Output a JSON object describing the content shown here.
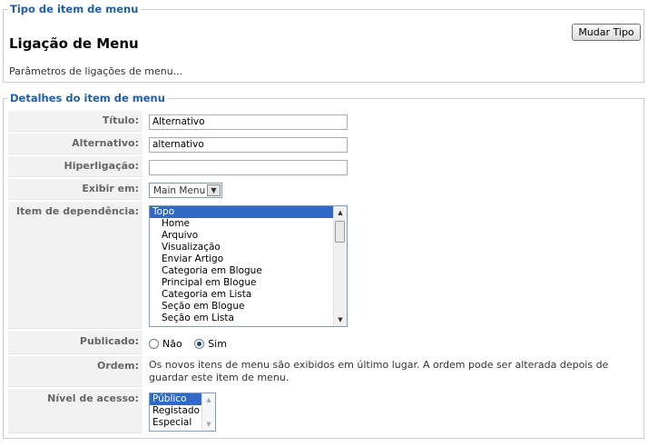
{
  "type_section": {
    "legend": "Tipo de item de menu",
    "title": "Ligação de Menu",
    "params_text": "Parâmetros de ligações de menu...",
    "change_type_label": "Mudar Tipo"
  },
  "details": {
    "legend": "Detalhes do item de menu",
    "title_label": "Título:",
    "title_value": "Alternativo",
    "alias_label": "Alternativo:",
    "alias_value": "alternativo",
    "link_label": "Hiperligação:",
    "link_value": "",
    "display_label": "Exibir em:",
    "display_value": "Main Menu",
    "parent_label": "Item de dependência:",
    "parent_options": [
      "Topo",
      "Home",
      "Arquivo",
      "Visualização",
      "Enviar Artigo",
      "Categoria em Blogue",
      "Principal em Blogue",
      "Categoria em Lista",
      "Seção em Blogue",
      "Seção em Lista"
    ],
    "published_label": "Publicado:",
    "published_no": "Não",
    "published_yes": "Sim",
    "order_label": "Ordem:",
    "order_text": "Os novos itens de menu são exibidos em último lugar. A ordem pode ser alterada depois de guardar este item de menu.",
    "access_label": "Nível de acesso:",
    "access_options": [
      "Público",
      "Registado",
      "Especial"
    ]
  }
}
